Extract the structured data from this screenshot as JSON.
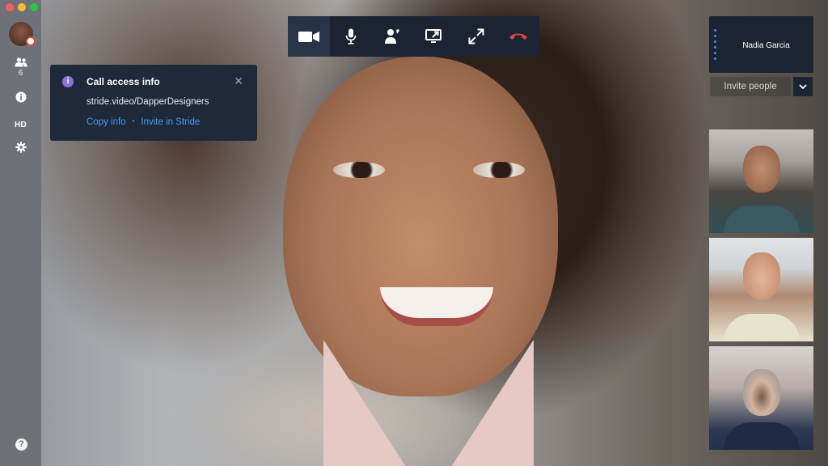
{
  "window": {
    "traffic_lights": [
      "close",
      "minimize",
      "maximize"
    ]
  },
  "sidebar": {
    "avatar": "user-avatar",
    "people_count": "6",
    "hd_label": "HD",
    "help_glyph": "?"
  },
  "info_panel": {
    "icon_glyph": "i",
    "title": "Call access info",
    "url": "stride.video/DapperDesigners",
    "copy_label": "Copy info",
    "separator": "•",
    "invite_label": "Invite in Stride",
    "close_glyph": "✕"
  },
  "toolbar": {
    "items": [
      {
        "name": "video-camera",
        "active": true
      },
      {
        "name": "microphone",
        "active": false
      },
      {
        "name": "raise-hand",
        "active": false
      },
      {
        "name": "screen-share",
        "active": false
      },
      {
        "name": "fullscreen",
        "active": false
      },
      {
        "name": "hang-up",
        "active": false
      }
    ]
  },
  "roster": {
    "current_speaker": "Nadia Garcia"
  },
  "invite": {
    "label": "Invite people"
  },
  "participants": [
    "participant-1",
    "participant-2",
    "participant-3"
  ],
  "colors": {
    "panel_bg": "#1e2a3a",
    "toolbar_bg": "#1c2332",
    "link_blue": "#4a9af4",
    "hangup_red": "#e2483d",
    "sidebar_bg": "#6e7278"
  }
}
